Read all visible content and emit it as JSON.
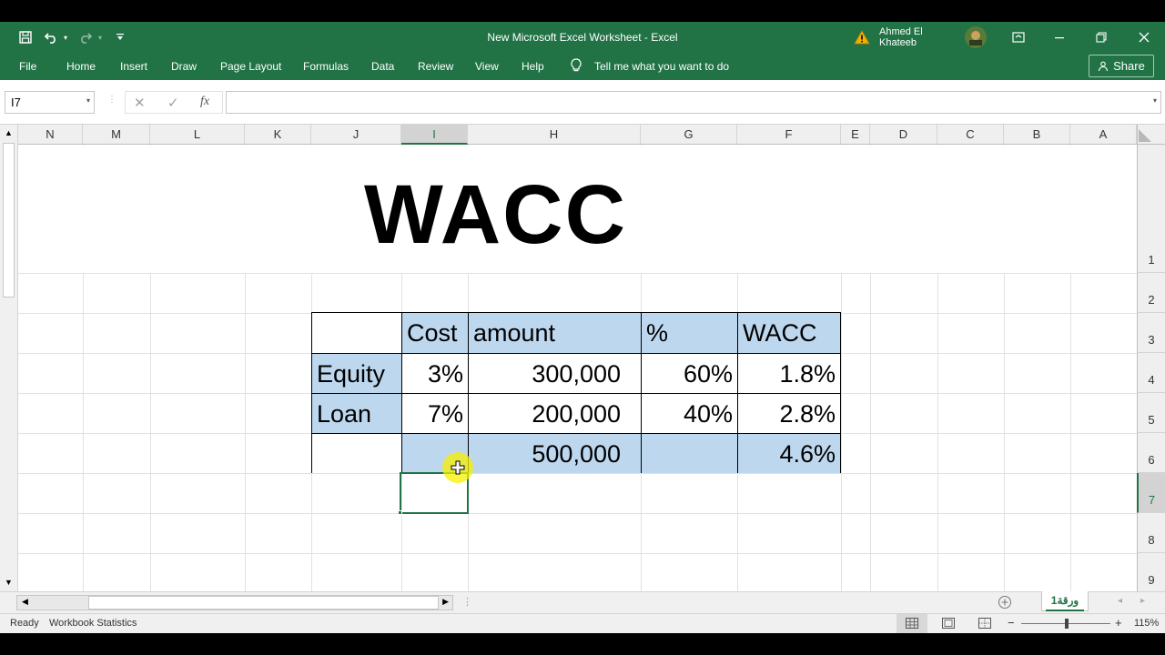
{
  "window": {
    "title": "New Microsoft Excel Worksheet  -  Excel",
    "user": "Ahmed El Khateeb",
    "accent": "#217346"
  },
  "ribbon": {
    "tabs": [
      "File",
      "Home",
      "Insert",
      "Draw",
      "Page Layout",
      "Formulas",
      "Data",
      "Review",
      "View",
      "Help"
    ],
    "tell_me": "Tell me what you want to do",
    "share": "Share"
  },
  "formula_bar": {
    "name_box": "I7",
    "fx": "fx",
    "value": ""
  },
  "columns": [
    "N",
    "M",
    "L",
    "K",
    "J",
    "I",
    "H",
    "G",
    "F",
    "E",
    "D",
    "C",
    "B",
    "A"
  ],
  "rows": [
    "1",
    "2",
    "3",
    "4",
    "5",
    "6",
    "7",
    "8",
    "9"
  ],
  "sheet": {
    "title": "WACC",
    "headers": {
      "cost": "Cost",
      "amount": "amount",
      "pct": "%",
      "wacc": "WACC"
    },
    "equity": {
      "label": "Equity",
      "cost": "3%",
      "amount": "300,000",
      "pct": "60%",
      "wacc": "1.8%"
    },
    "loan": {
      "label": "Loan",
      "cost": "7%",
      "amount": "200,000",
      "pct": "40%",
      "wacc": "2.8%"
    },
    "total": {
      "amount": "500,000",
      "wacc": "4.6%"
    },
    "fill_color": "#bdd7ee"
  },
  "sheet_tab": "ورقة1",
  "status": {
    "ready": "Ready",
    "stats": "Workbook Statistics",
    "zoom": "115%"
  }
}
